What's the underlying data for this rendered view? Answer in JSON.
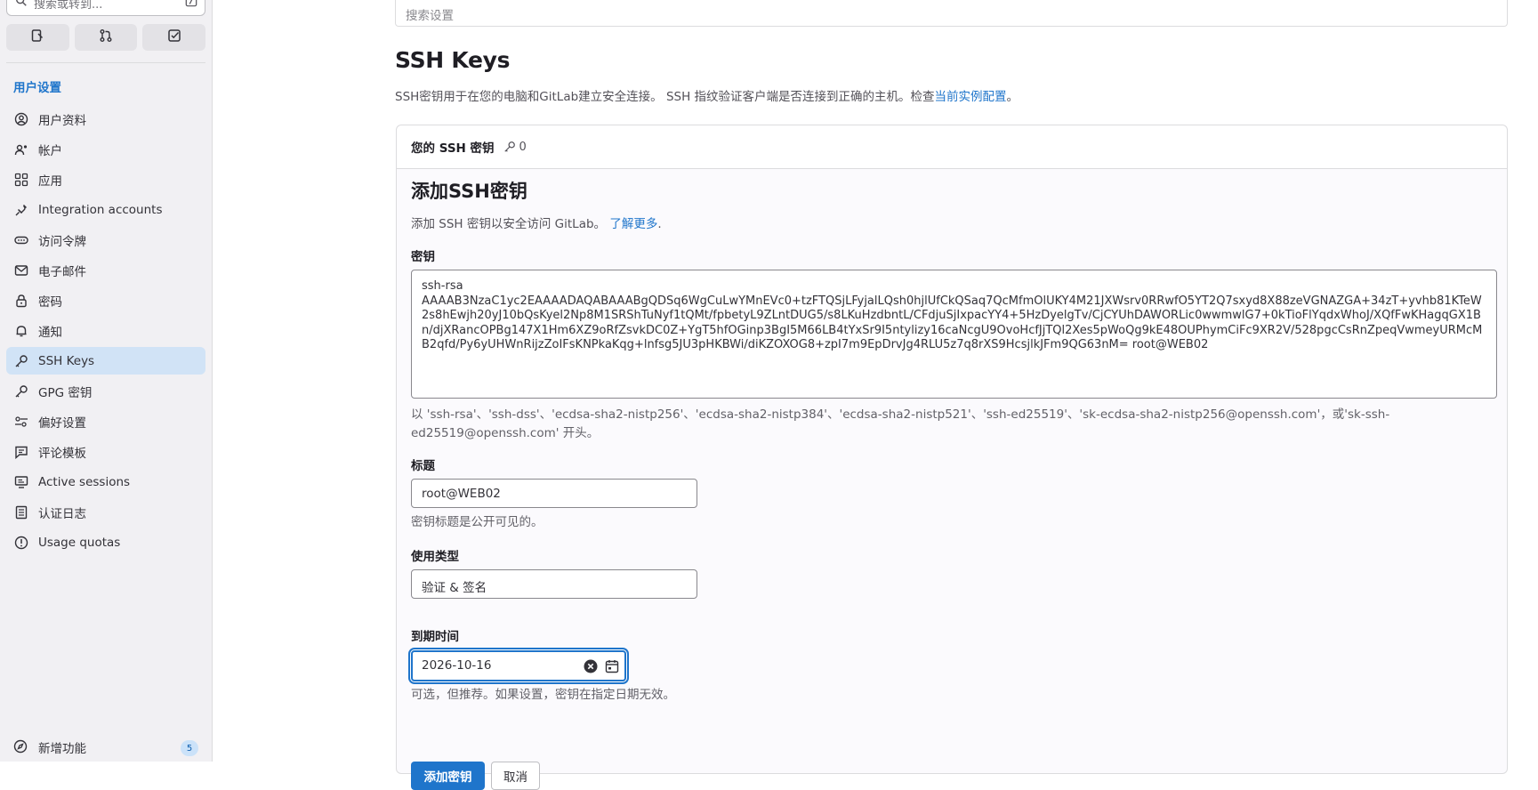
{
  "sidebar": {
    "search_placeholder": "搜索或转到...",
    "section_title": "用户设置",
    "items": [
      {
        "label": "用户资料",
        "icon": "user-circle-icon"
      },
      {
        "label": "帐户",
        "icon": "account-icon"
      },
      {
        "label": "应用",
        "icon": "applications-icon"
      },
      {
        "label": "Integration accounts",
        "icon": "plug-icon"
      },
      {
        "label": "访问令牌",
        "icon": "token-icon"
      },
      {
        "label": "电子邮件",
        "icon": "mail-icon"
      },
      {
        "label": "密码",
        "icon": "lock-icon"
      },
      {
        "label": "通知",
        "icon": "bell-icon"
      },
      {
        "label": "SSH Keys",
        "icon": "key-icon",
        "active": true
      },
      {
        "label": "GPG 密钥",
        "icon": "key-icon"
      },
      {
        "label": "偏好设置",
        "icon": "preferences-icon"
      },
      {
        "label": "评论模板",
        "icon": "comment-icon"
      },
      {
        "label": "Active sessions",
        "icon": "monitor-icon"
      },
      {
        "label": "认证日志",
        "icon": "log-icon"
      },
      {
        "label": "Usage quotas",
        "icon": "quota-icon"
      }
    ],
    "whats_new": {
      "label": "新增功能",
      "count": "5"
    }
  },
  "main": {
    "search_placeholder": "搜索设置",
    "title": "SSH Keys",
    "description_prefix": "SSH密钥用于在您的电脑和GitLab建立安全连接。 SSH 指纹验证客户端是否连接到正确的主机。检查",
    "description_link": "当前实例配置",
    "description_suffix": "。",
    "card": {
      "header_label": "您的 SSH 密钥",
      "key_count": "0",
      "form_title": "添加SSH密钥",
      "form_desc_prefix": "添加 SSH 密钥以安全访问 GitLab。",
      "form_desc_link": "了解更多",
      "form_desc_suffix": ".",
      "key_label": "密钥",
      "key_value": "ssh-rsa\nAAAAB3NzaC1yc2EAAAADAQABAAABgQDSq6WgCuLwYMnEVc0+tzFTQSjLFyjalLQsh0hjlUfCkQSaq7QcMfmOlUKY4M21JXWsrv0RRwfO5YT2Q7sxyd8X88zeVGNAZGA+34zT+yvhb81KTeW2s8hEwjh20yJ10bQsKyel2Np8M1SRShTuNyf1tQMt/fpbetyL9ZLntDUG5/s8LKuHzdbntL/CFdjuSjIxpacYY4+5HzDyelgTv/CjCYUhDAWORLic0wwmwlG7+0kTioFlYqdxWhoJ/XQfFwKHagqGX1Bn/djXRancOPBg147X1Hm6XZ9oRfZsvkDC0Z+YgT5hfOGinp3BgI5M66LB4tYxSr9I5ntylizy16caNcgU9OvoHcfJjTQl2Xes5pWoQg9kE48OUPhymCiFc9XR2V/528pgcCsRnZpeqVwmeyURMcMB2qfd/Py6yUHWnRijzZoIFsKNPkaKqg+lnfsg5JU3pHKBWi/diKZOXOG8+zpI7m9EpDrvJg4RLU5z7q8rXS9HcsjlkJFm9QG63nM= root@WEB02",
      "key_help": "以 'ssh-rsa'、'ssh-dss'、'ecdsa-sha2-nistp256'、'ecdsa-sha2-nistp384'、'ecdsa-sha2-nistp521'、'ssh-ed25519'、'sk-ecdsa-sha2-nistp256@openssh.com'，或'sk-ssh-ed25519@openssh.com' 开头。",
      "title_label": "标题",
      "title_value": "root@WEB02",
      "title_help": "密钥标题是公开可见的。",
      "usage_label": "使用类型",
      "usage_value": "验证 & 签名",
      "expiry_label": "到期时间",
      "expiry_value": "2026-10-16",
      "expiry_help": "可选，但推荐。如果设置，密钥在指定日期无效。",
      "add_button": "添加密钥",
      "cancel_button": "取消"
    }
  },
  "colors": {
    "accent": "#1f75cb",
    "sidebar_bg": "#f1f0f3",
    "active_item_bg": "#d1e3f6"
  }
}
